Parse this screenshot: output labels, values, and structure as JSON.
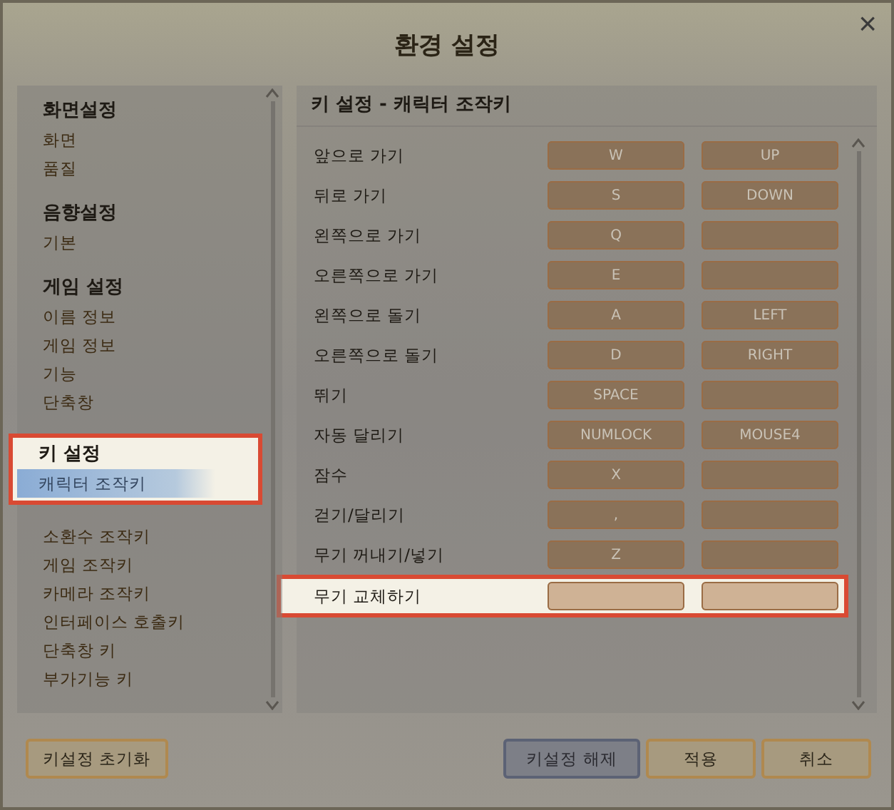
{
  "window": {
    "title": "환경 설정",
    "close": "×"
  },
  "sidebar": {
    "groups": [
      {
        "heading": "화면설정",
        "highlighted": false,
        "items": [
          {
            "label": "화면",
            "selected": false
          },
          {
            "label": "품질",
            "selected": false
          }
        ]
      },
      {
        "heading": "음향설정",
        "highlighted": false,
        "items": [
          {
            "label": "기본",
            "selected": false
          }
        ]
      },
      {
        "heading": "게임 설정",
        "highlighted": false,
        "items": [
          {
            "label": "이름 정보",
            "selected": false
          },
          {
            "label": "게임 정보",
            "selected": false
          },
          {
            "label": "기능",
            "selected": false
          },
          {
            "label": "단축창",
            "selected": false
          }
        ]
      },
      {
        "heading": "키 설정",
        "highlighted": true,
        "items": [
          {
            "label": "캐릭터 조작키",
            "selected": true
          }
        ]
      },
      {
        "highlighted": false,
        "items": [
          {
            "label": "소환수 조작키",
            "selected": false
          },
          {
            "label": "게임 조작키",
            "selected": false
          },
          {
            "label": "카메라 조작키",
            "selected": false
          },
          {
            "label": "인터페이스 호출키",
            "selected": false
          },
          {
            "label": "단축창 키",
            "selected": false
          },
          {
            "label": "부가기능 키",
            "selected": false
          }
        ]
      }
    ]
  },
  "panel": {
    "title": "키 설정 - 캐릭터 조작키",
    "rows": [
      {
        "action": "앞으로 가기",
        "primary": "W",
        "secondary": "UP",
        "highlighted": false
      },
      {
        "action": "뒤로 가기",
        "primary": "S",
        "secondary": "DOWN",
        "highlighted": false
      },
      {
        "action": "왼쪽으로 가기",
        "primary": "Q",
        "highlighted": false
      },
      {
        "action": "오른쪽으로 가기",
        "primary": "E",
        "highlighted": false
      },
      {
        "action": "왼쪽으로 돌기",
        "primary": "A",
        "secondary": "LEFT",
        "highlighted": false
      },
      {
        "action": "오른쪽으로 돌기",
        "primary": "D",
        "secondary": "RIGHT",
        "highlighted": false
      },
      {
        "action": "뛰기",
        "primary": "SPACE",
        "highlighted": false
      },
      {
        "action": "자동 달리기",
        "primary": "NUMLOCK",
        "secondary": "MOUSE4",
        "highlighted": false
      },
      {
        "action": "잠수",
        "primary": "X",
        "highlighted": false
      },
      {
        "action": "걷기/달리기",
        "primary": ",",
        "highlighted": false
      },
      {
        "action": "무기 꺼내기/넣기",
        "primary": "Z",
        "highlighted": false
      },
      {
        "action": "무기 교체하기",
        "highlighted": true
      }
    ]
  },
  "footer": {
    "reset": "키설정 초기화",
    "buttons": [
      {
        "label": "키설정 해제",
        "kind": "secondary"
      },
      {
        "label": "적용",
        "kind": "primary"
      },
      {
        "label": "취소",
        "kind": "primary"
      }
    ]
  }
}
